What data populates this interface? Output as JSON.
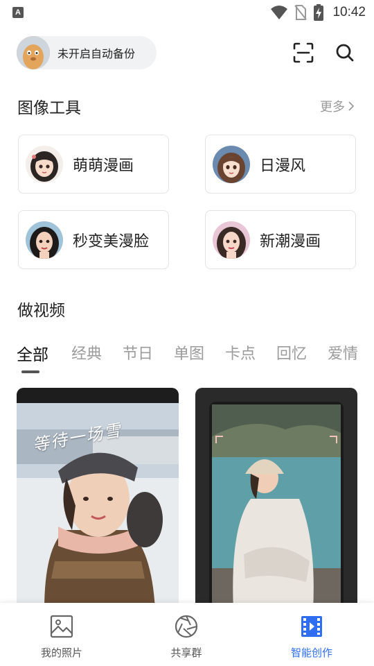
{
  "status_bar": {
    "app_badge": "A",
    "time": "10:42"
  },
  "header": {
    "backup_status": "未开启自动备份"
  },
  "image_tools": {
    "title": "图像工具",
    "more": "更多",
    "items": [
      {
        "label": "萌萌漫画"
      },
      {
        "label": "日漫风"
      },
      {
        "label": "秒变美漫脸"
      },
      {
        "label": "新潮漫画"
      }
    ]
  },
  "video": {
    "title": "做视频",
    "tabs": [
      "全部",
      "经典",
      "节日",
      "单图",
      "卡点",
      "回忆",
      "爱情"
    ],
    "active_tab": "全部",
    "cards": [
      {
        "overlay_text": "等待一场雪"
      },
      {
        "overlay_text": ""
      }
    ]
  },
  "bottom_nav": {
    "items": [
      {
        "label": "我的照片",
        "icon": "photo-icon"
      },
      {
        "label": "共享群",
        "icon": "aperture-icon"
      },
      {
        "label": "智能创作",
        "icon": "film-icon"
      }
    ],
    "active": "智能创作",
    "accent": "#2f6ef0"
  }
}
